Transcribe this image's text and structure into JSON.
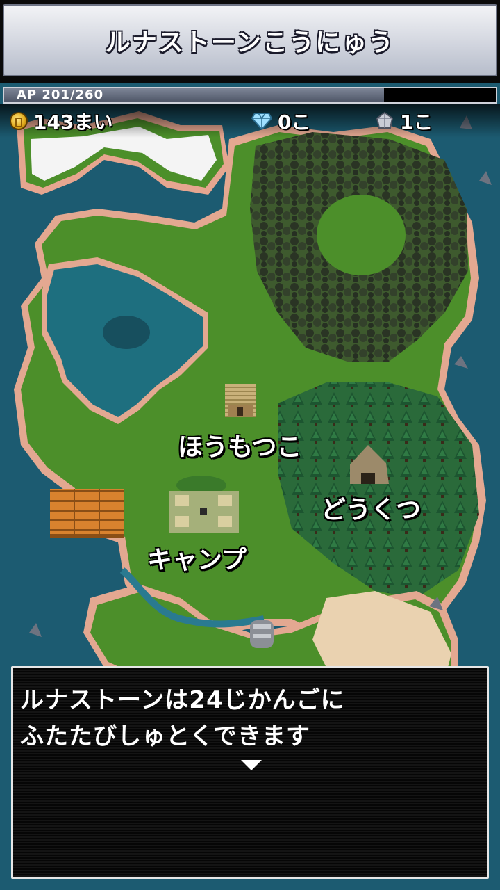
{
  "header": {
    "title": "ルナストーンこうにゅう"
  },
  "status": {
    "ap_text": "AP 201/260",
    "ap_fraction": 0.773
  },
  "currency": {
    "coins": "143まい",
    "diamonds": "0こ",
    "stones": "1こ"
  },
  "map": {
    "locations": [
      {
        "id": "storehouse",
        "label": "ほうもつこ"
      },
      {
        "id": "cave",
        "label": "どうくつ"
      },
      {
        "id": "camp",
        "label": "キャンプ"
      }
    ]
  },
  "message": {
    "line1": "ルナストーンは24じかんごに",
    "line2": "ふたたびしゅとくできます"
  },
  "colors": {
    "sea": "#1c5b71",
    "grass": "#4c8f2a",
    "shore": "#d8a890",
    "forest_dark": "#34402c",
    "forest_pine": "#1f5a34",
    "sand": "#ead2b0",
    "snow": "#f4f4f4"
  }
}
